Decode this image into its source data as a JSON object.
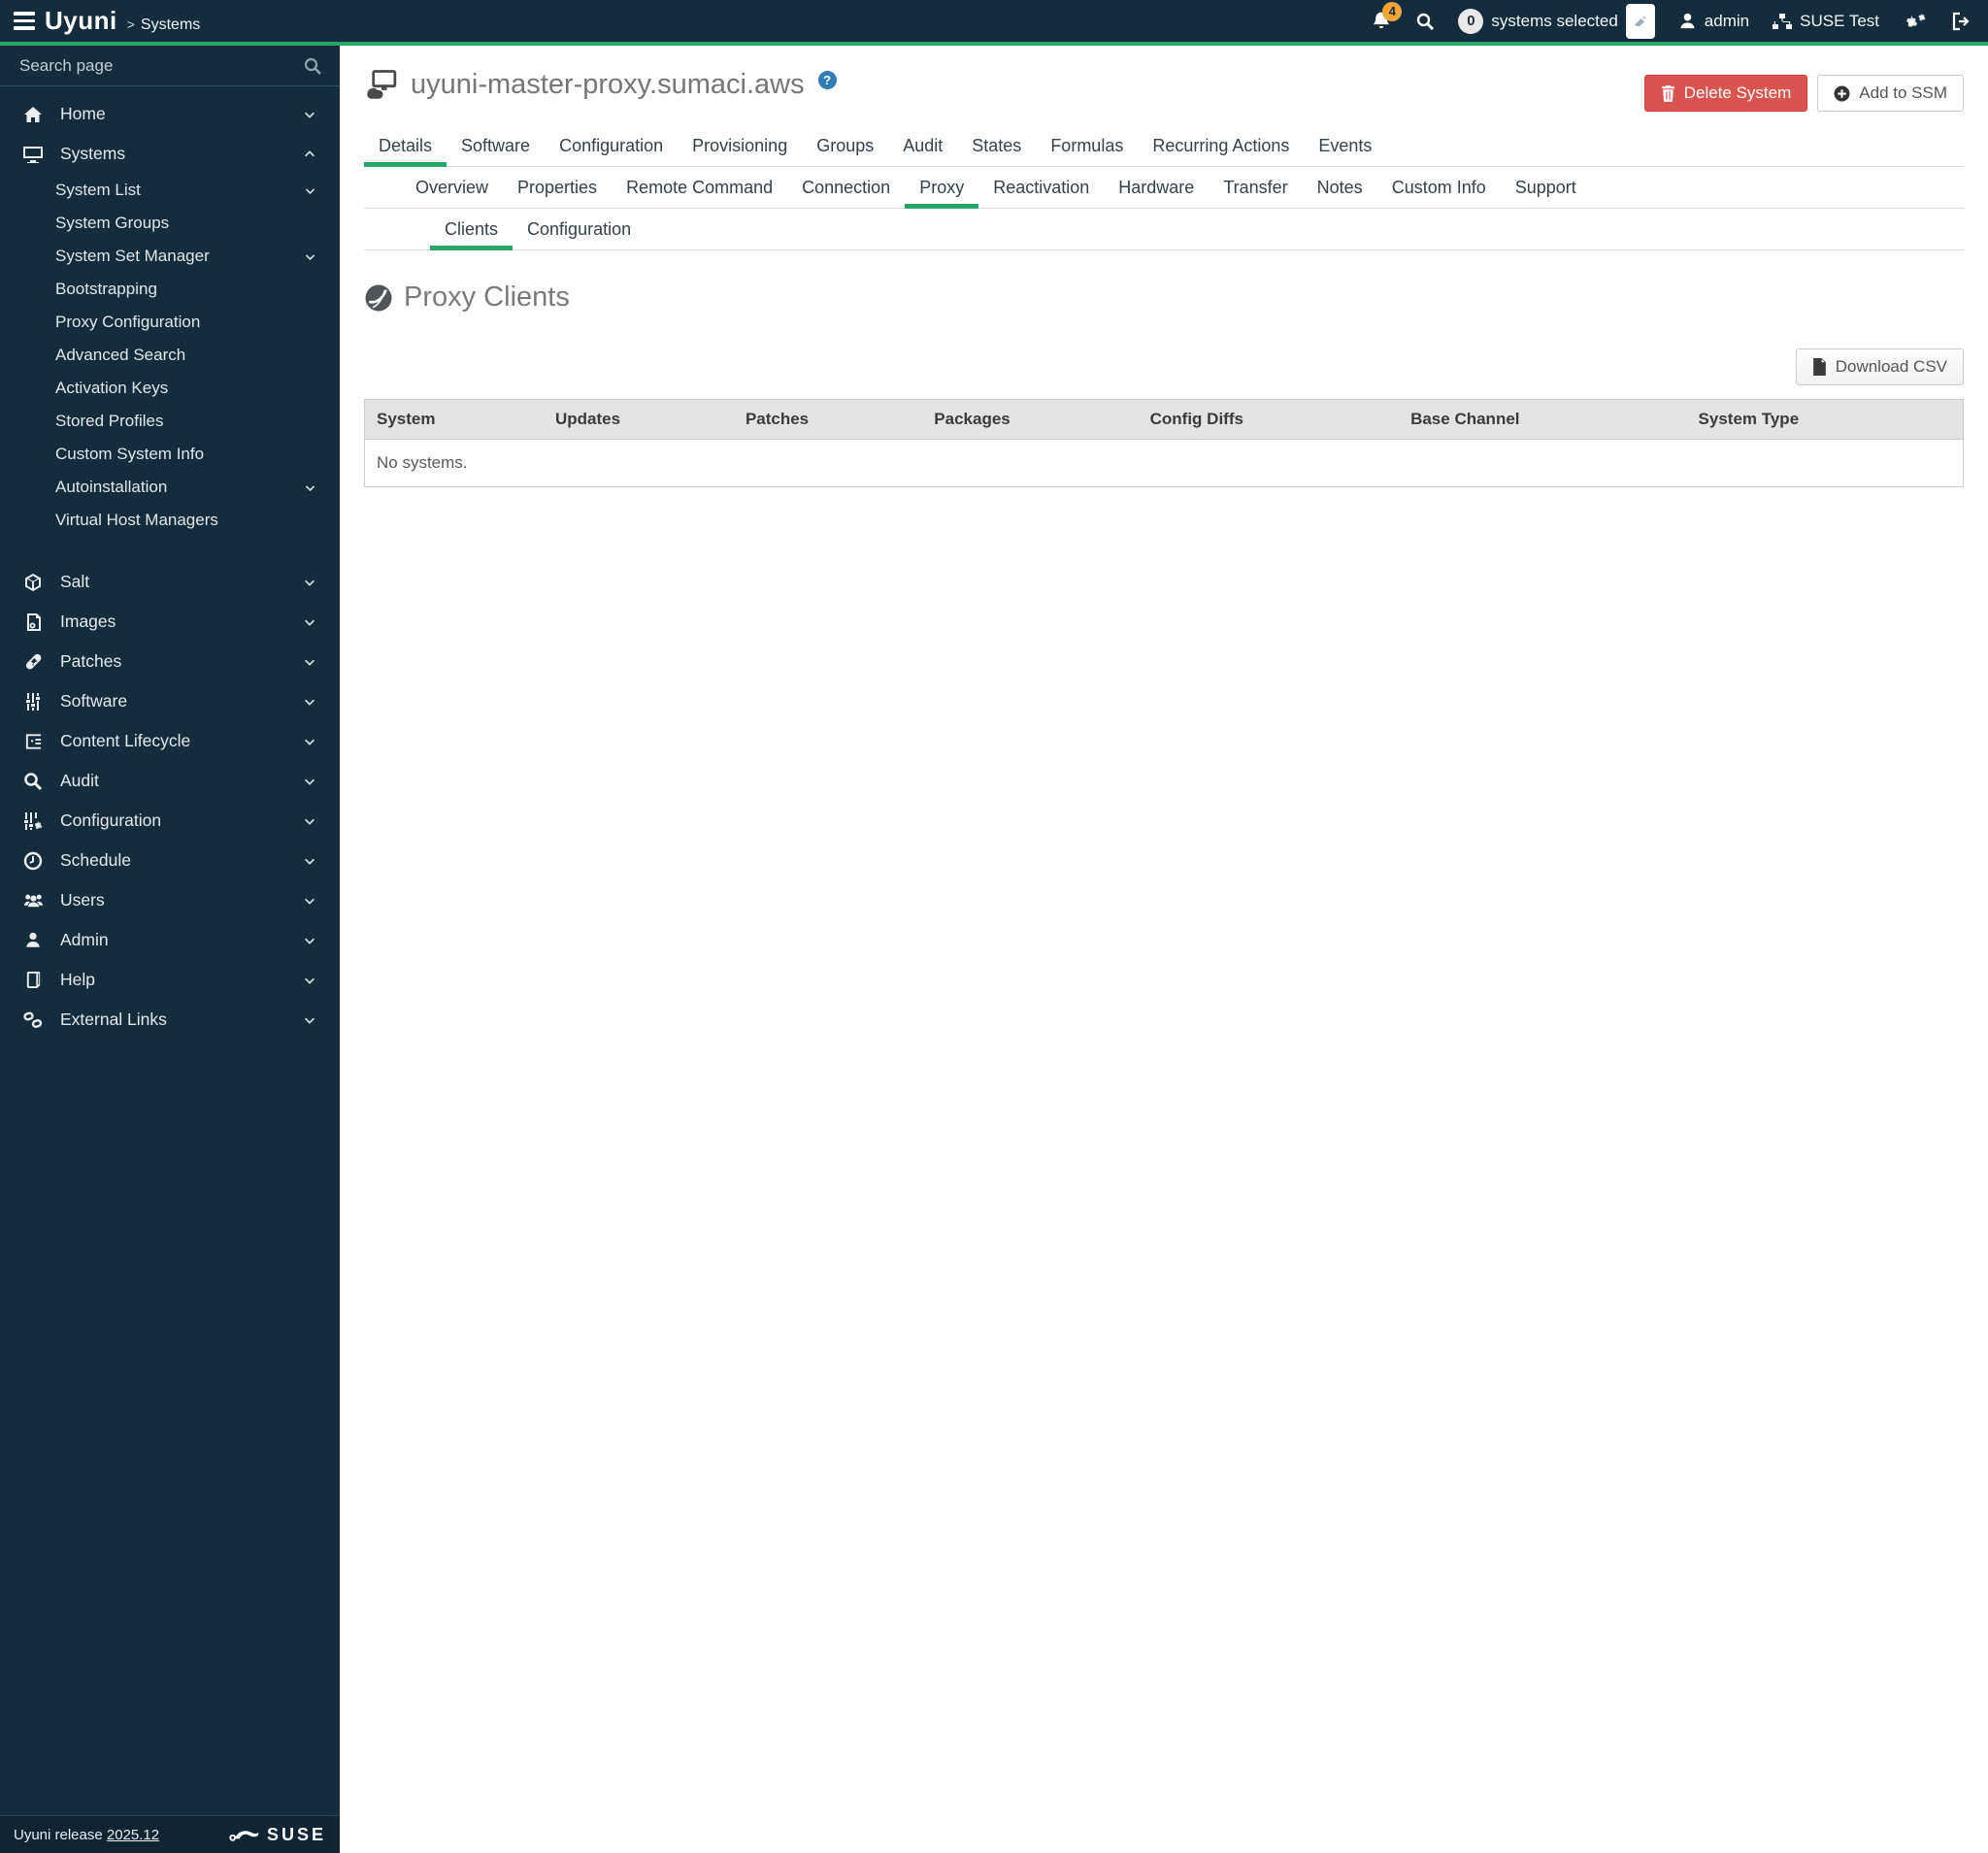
{
  "topbar": {
    "brand": "Uyuni",
    "breadcrumb_separator": ">",
    "breadcrumb": "Systems",
    "notification_count": "4",
    "selected_count": "0",
    "selected_label": "systems selected",
    "user_name": "admin",
    "org_name": "SUSE Test"
  },
  "sidebar": {
    "search_placeholder": "Search page",
    "items": [
      "Home",
      "Systems",
      "Salt",
      "Images",
      "Patches",
      "Software",
      "Content Lifecycle",
      "Audit",
      "Configuration",
      "Schedule",
      "Users",
      "Admin",
      "Help",
      "External Links"
    ],
    "systems_children": [
      "System List",
      "System Groups",
      "System Set Manager",
      "Bootstrapping",
      "Proxy Configuration",
      "Advanced Search",
      "Activation Keys",
      "Stored Profiles",
      "Custom System Info",
      "Autoinstallation",
      "Virtual Host Managers"
    ],
    "footer_release_prefix": "Uyuni release",
    "footer_release_version": "2025.12",
    "footer_brand": "SUSE"
  },
  "page": {
    "title": "uyuni-master-proxy.sumaci.aws",
    "help_icon": "?",
    "delete_button": "Delete System",
    "ssm_button": "Add to SSM",
    "tabs_level1": [
      "Details",
      "Software",
      "Configuration",
      "Provisioning",
      "Groups",
      "Audit",
      "States",
      "Formulas",
      "Recurring Actions",
      "Events"
    ],
    "tabs_level2": [
      "Overview",
      "Properties",
      "Remote Command",
      "Connection",
      "Proxy",
      "Reactivation",
      "Hardware",
      "Transfer",
      "Notes",
      "Custom Info",
      "Support"
    ],
    "tabs_level3": [
      "Clients",
      "Configuration"
    ],
    "section_title": "Proxy Clients",
    "download_csv_button": "Download CSV",
    "table": {
      "headers": [
        "System",
        "Updates",
        "Patches",
        "Packages",
        "Config Diffs",
        "Base Channel",
        "System Type"
      ],
      "empty_text": "No systems."
    }
  },
  "colors": {
    "topbar_bg": "#132d3e",
    "accent_green": "#28a567",
    "danger_red": "#d9534f",
    "badge_orange": "#f0a433",
    "help_blue": "#2e7cb8"
  }
}
